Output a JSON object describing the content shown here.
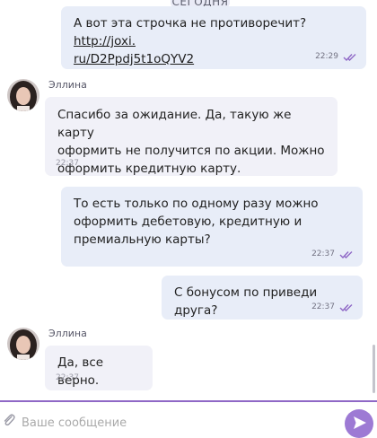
{
  "day_separator": "СЕГОДНЯ",
  "messages": [
    {
      "direction": "out",
      "text": "А вот эта строчка не противоречит? ",
      "link": "http://joxi.ru/D2Ppdj5t1oQYV2",
      "link_display_line1": "http://joxi.",
      "link_display_line2": "ru/D2Ppdj5t1oQYV2",
      "time": "22:29",
      "status": "read"
    },
    {
      "direction": "in",
      "sender": "Эллина",
      "line1": "Спасибо за ожидание. Да, такую же карту",
      "line2": "оформить не получится по акции. Можно",
      "line3": "оформить кредитную карту.",
      "time": "22:37"
    },
    {
      "direction": "out",
      "line1": "То есть только по одному разу можно",
      "line2": "оформить дебетовую, кредитную и",
      "line3": "премиальную карты?",
      "time": "22:37",
      "status": "read"
    },
    {
      "direction": "out",
      "text": "С бонусом по приведи друга?",
      "time": "22:37",
      "status": "read"
    },
    {
      "direction": "in",
      "sender": "Эллина",
      "text": "Да, все верно.",
      "time": "22:37"
    }
  ],
  "composer": {
    "placeholder": "Ваше сообщение"
  },
  "colors": {
    "outgoing_bubble": "#e8edf8",
    "incoming_bubble": "#f1f1f8",
    "accent": "#9d7ad4",
    "read_check": "#8f68c6"
  }
}
